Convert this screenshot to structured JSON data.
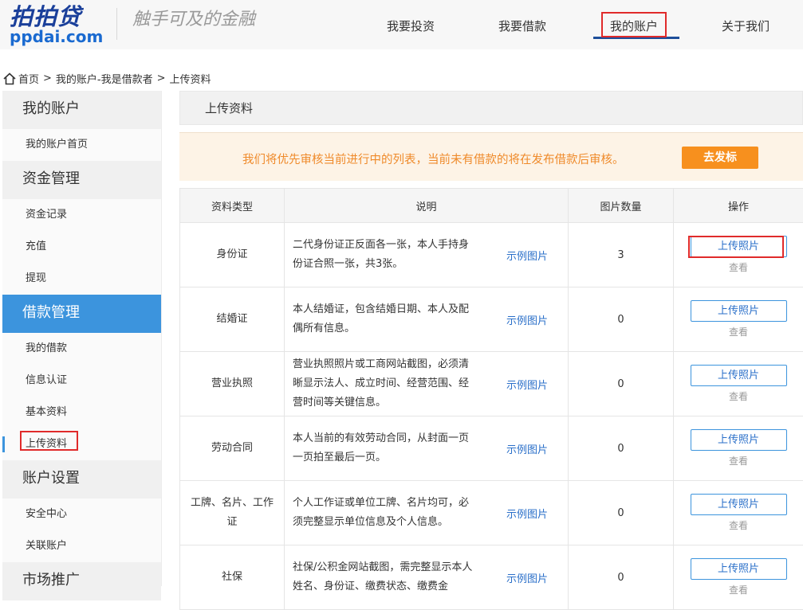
{
  "header": {
    "logo_main": "拍拍贷",
    "logo_sub": "ppdai.com",
    "slogan": "触手可及的金融",
    "nav": [
      "我要投资",
      "我要借款",
      "我的账户",
      "关于我们"
    ]
  },
  "breadcrumb": [
    "首页",
    "我的账户-我是借款者",
    "上传资料"
  ],
  "breadcrumb_sep": ">",
  "sidebar": {
    "groups": [
      {
        "label": "我的账户",
        "items": [
          "我的账户首页"
        ]
      },
      {
        "label": "资金管理",
        "items": [
          "资金记录",
          "充值",
          "提现"
        ]
      },
      {
        "label": "借款管理",
        "items": [
          "我的借款",
          "信息认证",
          "基本资料",
          "上传资料"
        ]
      },
      {
        "label": "账户设置",
        "items": [
          "安全中心",
          "关联账户"
        ]
      },
      {
        "label": "市场推广",
        "items": []
      }
    ]
  },
  "main": {
    "title": "上传资料",
    "notice": "我们将优先审核当前进行中的列表，当前未有借款的将在发布借款后审核。",
    "notice_button": "去发标",
    "table": {
      "headers": [
        "资料类型",
        "说明",
        "图片数量",
        "操作"
      ],
      "sample_label": "示例图片",
      "upload_label": "上传照片",
      "view_label": "查看",
      "rows": [
        {
          "type": "身份证",
          "desc": "二代身份证正反面各一张，本人手持身份证合照一张，共3张。",
          "count": "3"
        },
        {
          "type": "结婚证",
          "desc": "本人结婚证，包含结婚日期、本人及配偶所有信息。",
          "count": "0"
        },
        {
          "type": "营业执照",
          "desc": "营业执照照片或工商网站截图，必须清晰显示法人、成立时间、经营范围、经营时间等关键信息。",
          "count": "0"
        },
        {
          "type": "劳动合同",
          "desc": "本人当前的有效劳动合同，从封面一页一页拍至最后一页。",
          "count": "0"
        },
        {
          "type": "工牌、名片、工作证",
          "desc": "个人工作证或单位工牌、名片均可，必须完整显示单位信息及个人信息。",
          "count": "0"
        },
        {
          "type": "社保",
          "desc": "社保/公积金网站截图，需完整显示本人姓名、身份证、缴费状态、缴费金",
          "count": "0"
        }
      ]
    }
  }
}
